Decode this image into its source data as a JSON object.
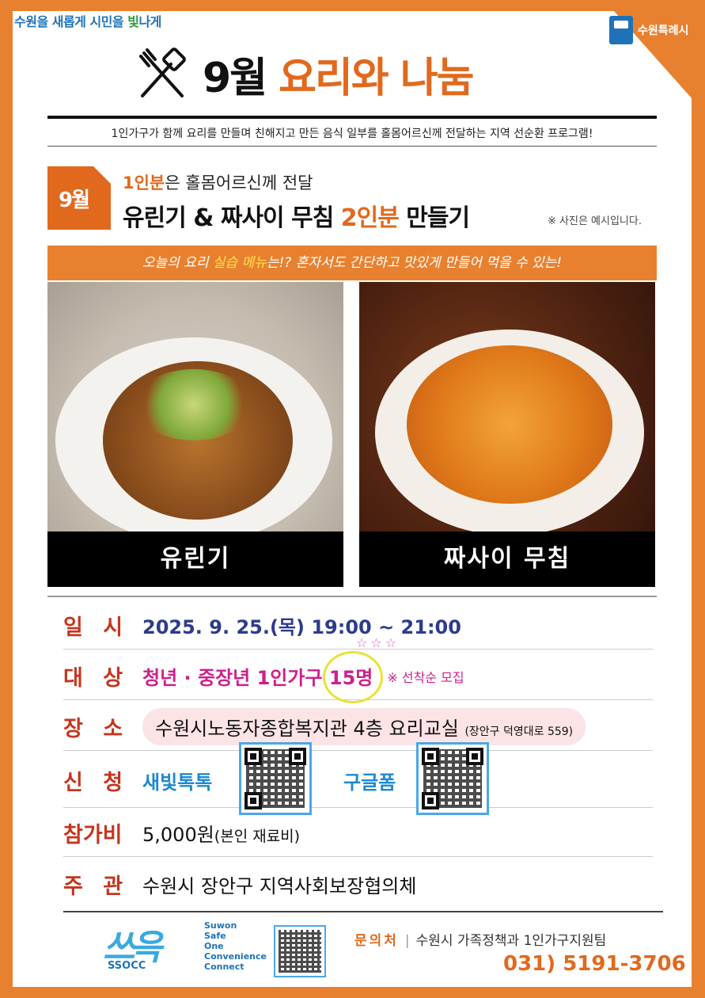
{
  "header": {
    "slogan_a": "수원을 ",
    "slogan_b": "새롭게 시민을 ",
    "slogan_c": "빛",
    "slogan_d": "나게",
    "city_logo_text": "수원특례시"
  },
  "title": {
    "part1": "9월 ",
    "part2": "요리와 나눔"
  },
  "intro": "1인가구가 함께 요리를 만들며 친해지고 만든 음식 일부를 홀몸어르신께 전달하는 지역 선순환 프로그램!",
  "month_tag": "9월",
  "sub1": {
    "highlight": "1인분",
    "rest": "은 홀몸어르신께 전달"
  },
  "sub2": {
    "a": "유린기 & 짜사이 무침 ",
    "highlight": "2인분",
    "b": " 만들기"
  },
  "note": "※ 사진은 예시입니다.",
  "menu_bar": {
    "a": "오늘의 요리 ",
    "highlight": "실습 메뉴",
    "b": "는!? 혼자서도 간단하고 맛있게 만들어 먹을 수 있는!"
  },
  "dishes": [
    {
      "name": "유린기"
    },
    {
      "name": "짜사이 무침"
    }
  ],
  "info": {
    "date_label": "일 시",
    "date": "2025. 9. 25.(목) 19:00 ~ 21:00",
    "target_label": "대 상",
    "target": "청년 · 중장년 1인가구 ",
    "target_count": "15명",
    "target_note": "※ 선착순 모집",
    "place_label": "장 소",
    "place": "수원시노동자종합복지관 4층 요리교실 ",
    "place_addr": "(장안구 덕영대로 559)",
    "apply_label": "신 청",
    "apply_a": "새빛톡톡",
    "apply_b": "구글폼",
    "fee_label": "참가비",
    "fee": "5,000원",
    "fee_note": "(본인 재료비)",
    "host_label": "주 관",
    "host": "수원시 장안구 지역사회보장협의체"
  },
  "footer": {
    "ssocc_logo": "쓰윽",
    "ssocc_tag": "SSOCC",
    "ssocc_lines": [
      "Suwon",
      "Safe",
      "One",
      "Convenience",
      "Connect"
    ],
    "contact_label": "문의처",
    "contact_org": "수원시 가족정책과 1인가구지원팀",
    "phone": "031) 5191-3706"
  },
  "colors": {
    "orange": "#e1691d",
    "blue": "#2d3b8c",
    "magenta": "#cf1f8a",
    "red": "#c4361e"
  }
}
